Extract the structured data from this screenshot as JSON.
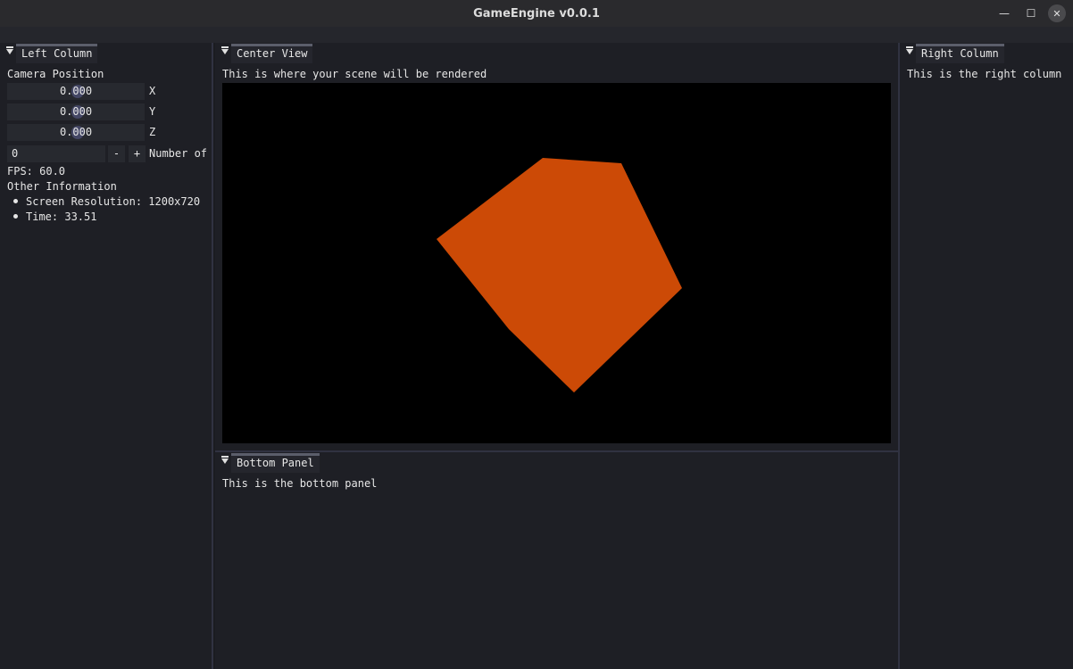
{
  "window": {
    "title": "GameEngine v0.0.1",
    "minimize_glyph": "—",
    "maximize_glyph": "☐",
    "close_glyph": "✕"
  },
  "left": {
    "title": "Left Column",
    "camera_label": "Camera Position",
    "x": {
      "value": "0.000",
      "label": "X"
    },
    "y": {
      "value": "0.000",
      "label": "Y"
    },
    "z": {
      "value": "0.000",
      "label": "Z"
    },
    "count_value": "0",
    "minus": "-",
    "plus": "+",
    "count_label": "Number of",
    "fps": "FPS: 60.0",
    "other_info": "Other Information",
    "resolution": "Screen Resolution: 1200x720",
    "time": "Time: 33.51"
  },
  "center": {
    "title": "Center View",
    "description": "This is where your scene will be rendered",
    "shape_color": "#cc4a06"
  },
  "bottom": {
    "title": "Bottom Panel",
    "text": "This is the bottom panel"
  },
  "right": {
    "title": "Right Column",
    "text": "This is the right column"
  }
}
